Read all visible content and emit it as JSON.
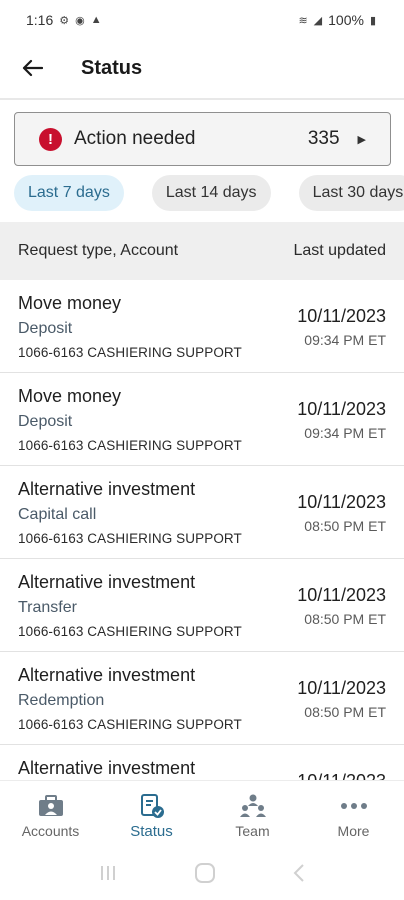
{
  "status_bar": {
    "time": "1:16",
    "battery": "100%"
  },
  "header": {
    "title": "Status"
  },
  "action_card": {
    "label": "Action needed",
    "count": "335"
  },
  "filters": [
    "Last 7 days",
    "Last 14 days",
    "Last 30 days"
  ],
  "table": {
    "col_left": "Request type, Account",
    "col_right": "Last updated",
    "rows": [
      {
        "type": "Move money",
        "sub": "Deposit",
        "account": "1066-6163 CASHIERING SUPPORT",
        "date": "10/11/2023",
        "time": "09:34 PM ET"
      },
      {
        "type": "Move money",
        "sub": "Deposit",
        "account": "1066-6163 CASHIERING SUPPORT",
        "date": "10/11/2023",
        "time": "09:34 PM ET"
      },
      {
        "type": "Alternative investment",
        "sub": "Capital call",
        "account": "1066-6163 CASHIERING SUPPORT",
        "date": "10/11/2023",
        "time": "08:50 PM ET"
      },
      {
        "type": "Alternative investment",
        "sub": "Transfer",
        "account": "1066-6163 CASHIERING SUPPORT",
        "date": "10/11/2023",
        "time": "08:50 PM ET"
      },
      {
        "type": "Alternative investment",
        "sub": "Redemption",
        "account": "1066-6163 CASHIERING SUPPORT",
        "date": "10/11/2023",
        "time": "08:50 PM ET"
      },
      {
        "type": "Alternative investment",
        "sub": "",
        "account": "",
        "date": "10/11/2023",
        "time": ""
      }
    ]
  },
  "bottom_nav": [
    {
      "label": "Accounts",
      "icon": "briefcase-icon"
    },
    {
      "label": "Status",
      "icon": "status-document-icon"
    },
    {
      "label": "Team",
      "icon": "team-icon"
    },
    {
      "label": "More",
      "icon": "more-dots-icon"
    }
  ],
  "colors": {
    "accent": "#2b6c8f",
    "alert": "#c8102e",
    "chip_active_bg": "#e0f1fa"
  }
}
